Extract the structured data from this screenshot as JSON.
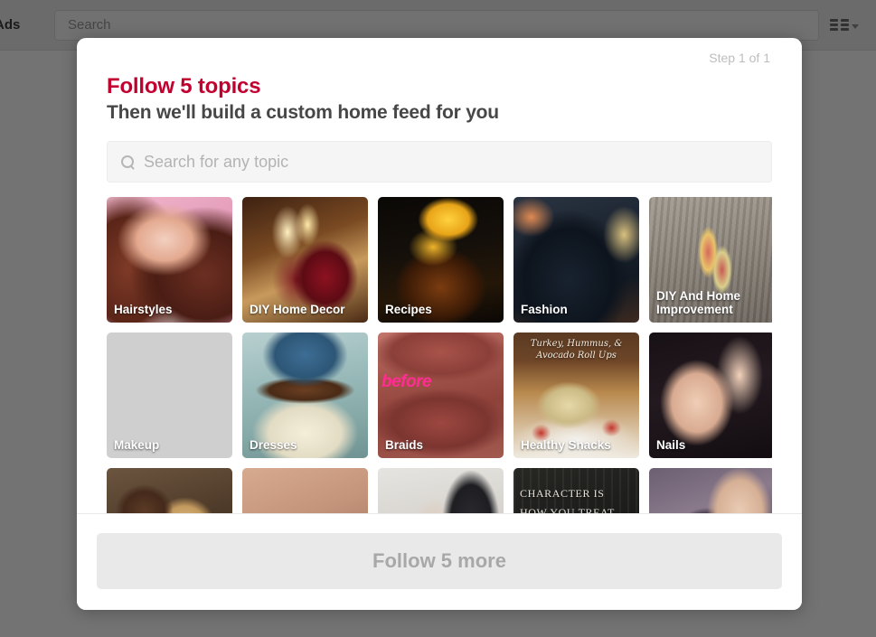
{
  "topnav": {
    "brand_label": "Ads",
    "search_placeholder": "Search",
    "grid_icon": "grid-menu-icon",
    "caret_icon": "chevron-down-icon"
  },
  "modal": {
    "step_indicator": "Step 1 of 1",
    "title": "Follow 5 topics",
    "subtitle": "Then we'll build a custom home feed for you",
    "search": {
      "icon": "search-icon",
      "placeholder": "Search for any topic",
      "value": ""
    },
    "topics": [
      {
        "label": "Hairstyles",
        "art": "art-hairstyles"
      },
      {
        "label": "DIY Home Decor",
        "art": "art-diyhome"
      },
      {
        "label": "Recipes",
        "art": "art-recipes"
      },
      {
        "label": "Fashion",
        "art": "art-fashion"
      },
      {
        "label": "DIY And Home Improvement",
        "art": "art-diyimprove"
      },
      {
        "label": "Makeup",
        "art": "art-makeup"
      },
      {
        "label": "Dresses",
        "art": "art-dresses"
      },
      {
        "label": "Braids",
        "art": "art-braids",
        "overlay_text": "before"
      },
      {
        "label": "Healthy Snacks",
        "art": "art-healthysnacks",
        "inner_text": "Turkey, Hummus, & Avocado Roll Ups"
      },
      {
        "label": "Nails",
        "art": "art-nails"
      },
      {
        "label": "",
        "art": "art-cookies"
      },
      {
        "label": "",
        "art": "art-eyebrow"
      },
      {
        "label": "",
        "art": "art-outfit"
      },
      {
        "label": "",
        "art": "art-quote",
        "quote_text": "CHARACTER IS HOW YOU TREAT THOSE WHO CAN"
      },
      {
        "label": "",
        "art": "art-heels"
      }
    ],
    "footer": {
      "follow_button_label": "Follow 5 more"
    }
  },
  "colors": {
    "brand_red": "#c2002f",
    "subtitle_gray": "#474747",
    "step_gray": "#bdbdbd",
    "button_bg": "#e9e9e9",
    "button_text": "#a8a8a8",
    "overlay": "rgba(0,0,0,0.55)"
  }
}
